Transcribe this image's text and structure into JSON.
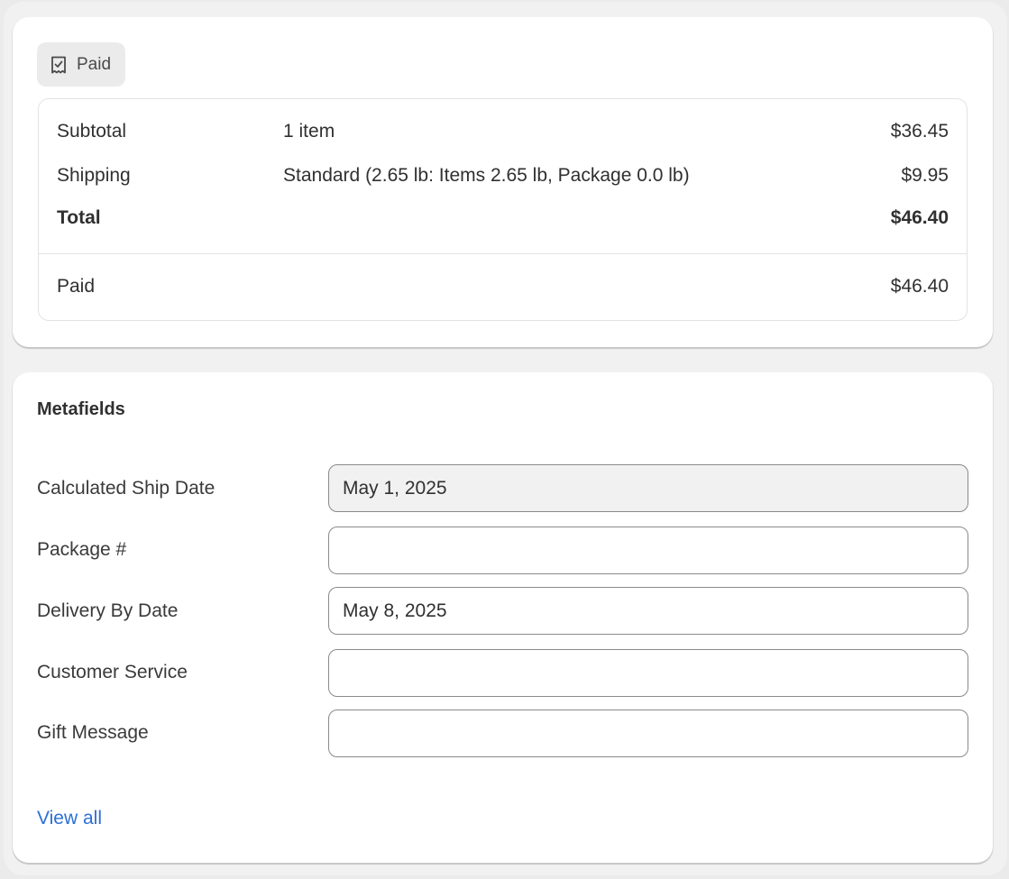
{
  "payment": {
    "status_badge": "Paid",
    "status_icon": "receipt-check-icon",
    "rows": [
      {
        "label": "Subtotal",
        "detail": "1 item",
        "amount": "$36.45"
      },
      {
        "label": "Shipping",
        "detail": "Standard (2.65 lb: Items 2.65 lb, Package 0.0 lb)",
        "amount": "$9.95"
      },
      {
        "label": "Total",
        "detail": "",
        "amount": "$46.40"
      }
    ],
    "paid": {
      "label": "Paid",
      "amount": "$46.40"
    }
  },
  "metafields": {
    "title": "Metafields",
    "fields": [
      {
        "label": "Calculated Ship Date",
        "value": "May 1, 2025",
        "disabled": true
      },
      {
        "label": "Package #",
        "value": ""
      },
      {
        "label": "Delivery By Date",
        "value": "May 8, 2025"
      },
      {
        "label": "Customer Service",
        "value": ""
      },
      {
        "label": "Gift Message",
        "value": ""
      }
    ],
    "view_all_label": "View all"
  },
  "colors": {
    "link": "#2b6fd6",
    "page_background": "#f1f1f1",
    "card_background": "#ffffff",
    "badge_background": "#ebebeb"
  }
}
